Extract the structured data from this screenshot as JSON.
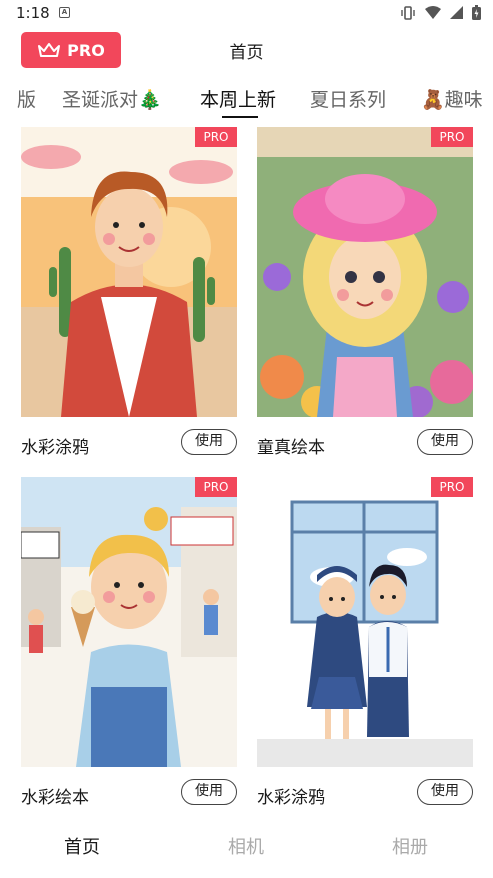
{
  "status_bar": {
    "time": "1:18",
    "notif_letter": "A"
  },
  "header": {
    "pro_label": "PRO",
    "title": "首页"
  },
  "tabs": [
    {
      "label": "版"
    },
    {
      "label": "圣诞派对🎄"
    },
    {
      "label": "本周上新",
      "active": true
    },
    {
      "label": "夏日系列"
    },
    {
      "label": "🧸趣味"
    }
  ],
  "cards": [
    {
      "title": "水彩涂鸦",
      "tag": "PRO",
      "use_label": "使用",
      "image": "watercolor boy with cactus"
    },
    {
      "title": "童真绘本",
      "tag": "PRO",
      "use_label": "使用",
      "image": "girl with pink hat in flowers"
    },
    {
      "title": "水彩绘本",
      "tag": "PRO",
      "use_label": "使用",
      "image": "girl with ice cream in street"
    },
    {
      "title": "水彩涂鸦",
      "tag": "PRO",
      "use_label": "使用",
      "image": "school couple by window"
    }
  ],
  "bottom_nav": [
    {
      "label": "首页",
      "active": true
    },
    {
      "label": "相机"
    },
    {
      "label": "相册"
    }
  ],
  "colors": {
    "accent": "#f2475b",
    "inactive_nav": "#aaaaaa"
  }
}
